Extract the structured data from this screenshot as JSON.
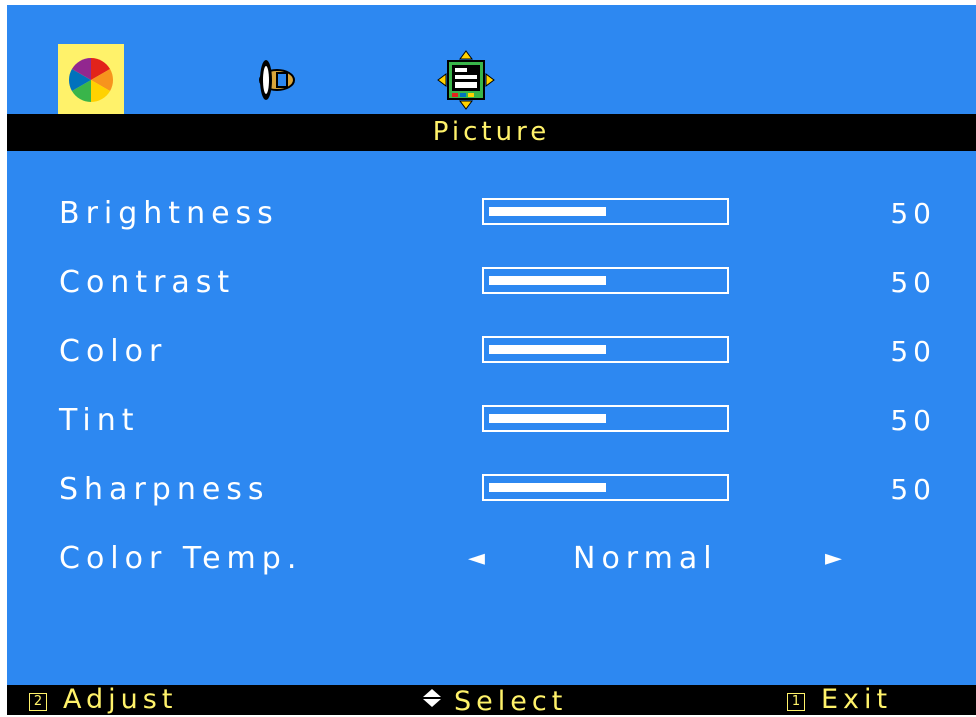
{
  "tabs": [
    {
      "name": "picture",
      "icon": "color-wheel-icon",
      "active": true
    },
    {
      "name": "audio",
      "icon": "speaker-icon",
      "active": false
    },
    {
      "name": "display",
      "icon": "screen-position-icon",
      "active": false
    }
  ],
  "title": "Picture",
  "settings": [
    {
      "label": "Brightness",
      "value": "50",
      "level": 0.5
    },
    {
      "label": "Contrast",
      "value": "50",
      "level": 0.5
    },
    {
      "label": "Color",
      "value": "50",
      "level": 0.5
    },
    {
      "label": "Tint",
      "value": "50",
      "level": 0.5
    },
    {
      "label": "Sharpness",
      "value": "50",
      "level": 0.5
    }
  ],
  "color_temp": {
    "label": "Color Temp.",
    "value": "Normal",
    "left_arrow": "◄",
    "right_arrow": "►"
  },
  "footer": {
    "adjust_key": "2",
    "adjust_label": "Adjust",
    "select_label": "Select",
    "exit_key": "1",
    "exit_label": "Exit"
  },
  "colors": {
    "background": "#2d88f1",
    "bar": "#000000",
    "highlight": "#fff26a",
    "text": "#ffffff"
  }
}
